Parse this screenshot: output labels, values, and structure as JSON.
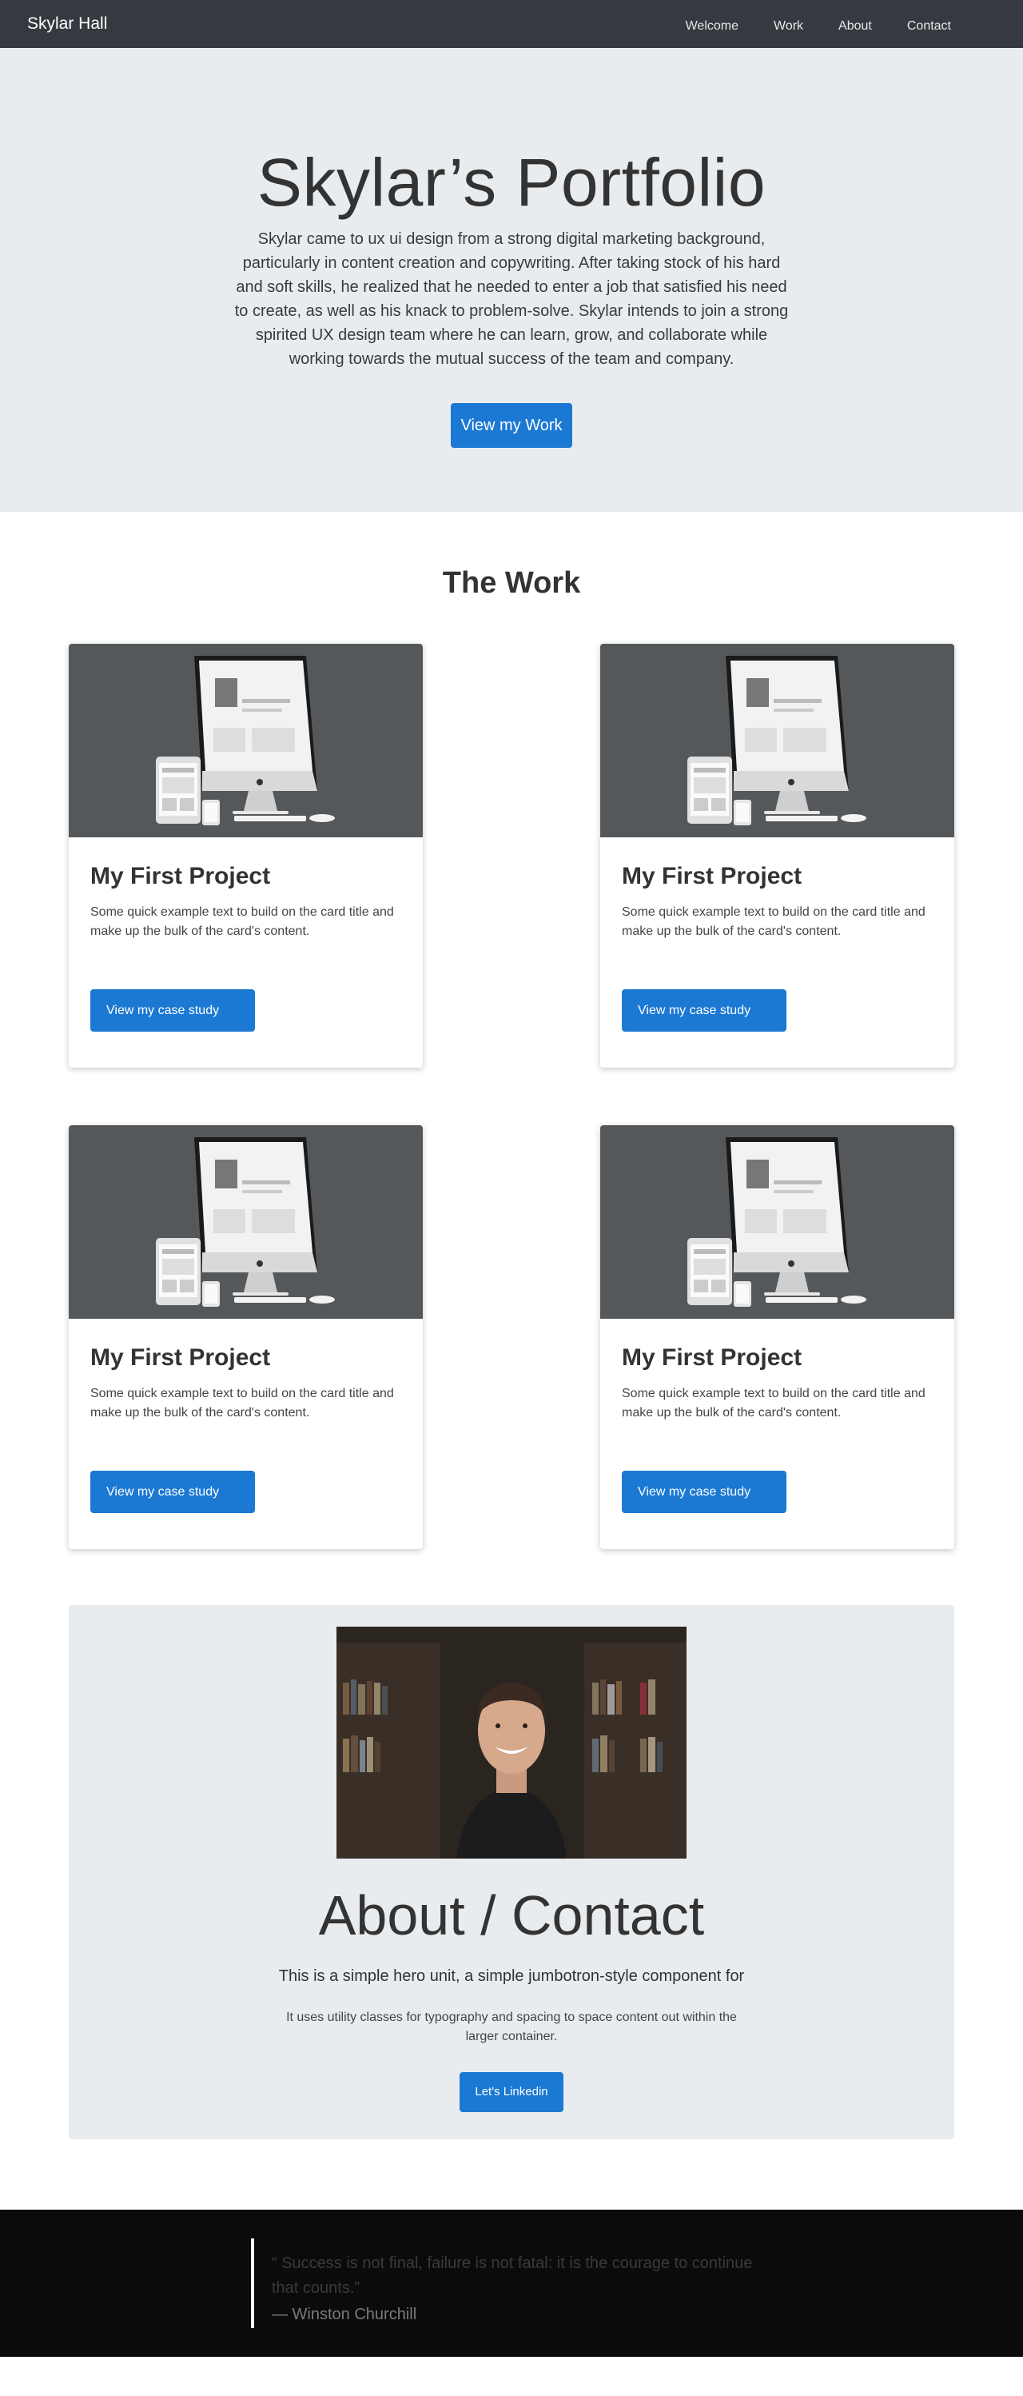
{
  "navbar": {
    "brand": "Skylar Hall",
    "links": [
      "Welcome",
      "Work",
      "About",
      "Contact"
    ]
  },
  "hero": {
    "title": "Skylar’s Portfolio",
    "text": "Skylar came to ux ui design from a strong digital marketing background, particularly in content creation and copywriting. After taking stock of his hard and soft skills, he realized that he needed to enter a job that satisfied his need to create, as well as his knack to problem-solve. Skylar intends to join a strong spirited UX design team where he can learn, grow, and collaborate while working towards the mutual success of the team and company.",
    "button": "View my Work"
  },
  "work": {
    "title": "The Work",
    "cards": [
      {
        "title": "My First Project",
        "text": "Some quick example text to build on the card title and make up the bulk of the card's content.",
        "button": "View my case study"
      },
      {
        "title": "My First Project",
        "text": "Some quick example text to build on the card title and make up the bulk of the card's content.",
        "button": "View my case study"
      },
      {
        "title": "My First Project",
        "text": "Some quick example text to build on the card title and make up the bulk of the card's content.",
        "button": "View my case study"
      },
      {
        "title": "My First Project",
        "text": "Some quick example text to build on the card title and make up the bulk of the card's content.",
        "button": "View my case study"
      }
    ]
  },
  "about": {
    "title": "About / Contact",
    "lead": "This is a simple hero unit, a simple jumbotron-style component for",
    "text": "It uses utility classes for typography and spacing to space content out within the larger container.",
    "button": "Let's Linkedin"
  },
  "footer": {
    "quote": "“ Success is not final, failure is not fatal: it is the courage to continue that counts.”",
    "author": "— Winston Churchill"
  },
  "colors": {
    "navbar": "#343a40",
    "hero_bg": "#e9ecef",
    "primary_button": "#1b79d3",
    "card_image_bg": "#55585b",
    "footer_bg": "#0b0b0b"
  }
}
